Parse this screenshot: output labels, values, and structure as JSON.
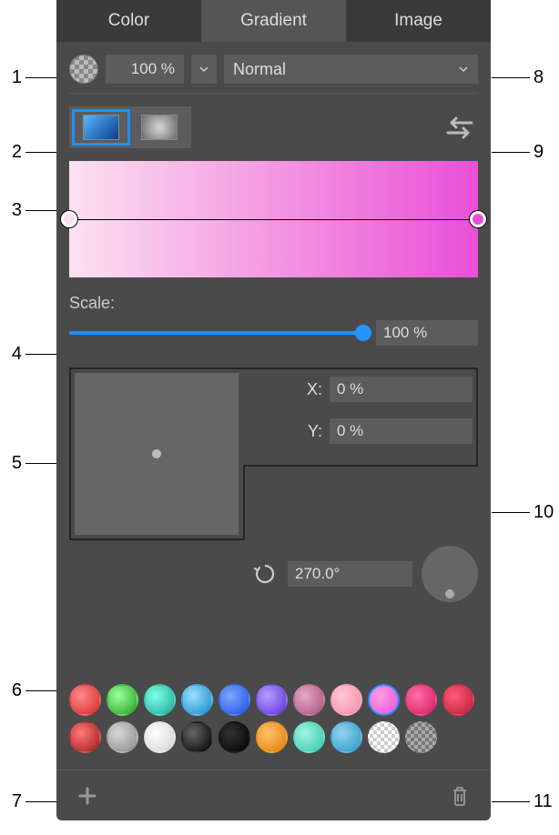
{
  "tabs": {
    "color": "Color",
    "gradient": "Gradient",
    "image": "Image"
  },
  "opacity": {
    "value": "100 %"
  },
  "blend": {
    "value": "Normal"
  },
  "scale": {
    "label": "Scale:",
    "value": "100 %"
  },
  "position": {
    "x_label": "X:",
    "x_value": "0 %",
    "y_label": "Y:",
    "y_value": "0 %"
  },
  "angle": {
    "value": "270.0°"
  },
  "presets": {
    "row1": [
      {
        "bg": "radial-gradient(circle at 35% 35%, #ff8a8a, #d12a2a)"
      },
      {
        "bg": "radial-gradient(circle at 35% 35%, #9dff9d, #1fa01f)"
      },
      {
        "bg": "radial-gradient(circle at 35% 35%, #7fffe9, #1aa892)"
      },
      {
        "bg": "radial-gradient(circle at 35% 35%, #9adfff, #1389c9)"
      },
      {
        "bg": "radial-gradient(circle at 35% 35%, #7aa8ff, #1b4fe0)"
      },
      {
        "bg": "radial-gradient(circle at 35% 35%, #b79dff, #5a30d6)"
      },
      {
        "bg": "radial-gradient(circle at 35% 35%, #e6a6c6, #a3537c)"
      },
      {
        "bg": "radial-gradient(circle at 35% 35%, #ffc9d8, #f28aa3)"
      },
      {
        "bg": "radial-gradient(circle at 35% 35%, #ff9de6, #e94fd6)",
        "selected": true
      },
      {
        "bg": "radial-gradient(circle at 35% 35%, #ff6fa6, #d41a62)"
      },
      {
        "bg": "radial-gradient(circle at 35% 35%, #ff5a7a, #b71d38)"
      }
    ],
    "row2": [
      {
        "bg": "radial-gradient(circle at 35% 35%, #ff7a7a, #a01818)"
      },
      {
        "bg": "radial-gradient(circle at 35% 35%, #d7d7d7, #8a8a8a)"
      },
      {
        "bg": "radial-gradient(circle at 35% 35%, #ffffff, #d0d0d0)"
      },
      {
        "bg": "radial-gradient(circle at 35% 35%, #666, #000)"
      },
      {
        "bg": "radial-gradient(circle at 35% 35%, #333, #000)"
      },
      {
        "bg": "radial-gradient(circle at 35% 35%, #ffc36b, #e07a00)"
      },
      {
        "bg": "radial-gradient(circle at 35% 35%, #a0f5e1, #2fc7a9)"
      },
      {
        "bg": "radial-gradient(circle at 35% 35%, #8fd5ef, #2a94c4)"
      },
      {
        "bg": "repeating-conic-gradient(#ccc 0 25%, #fff 0 50%) 0 0/8px 8px"
      },
      {
        "bg": "repeating-conic-gradient(#777 0 25%, #aaa 0 50%) 0 0/8px 8px"
      }
    ]
  },
  "callouts": {
    "c1": "1",
    "c2": "2",
    "c3": "3",
    "c4": "4",
    "c5": "5",
    "c6": "6",
    "c7": "7",
    "c8": "8",
    "c9": "9",
    "c10": "10",
    "c11": "11"
  }
}
